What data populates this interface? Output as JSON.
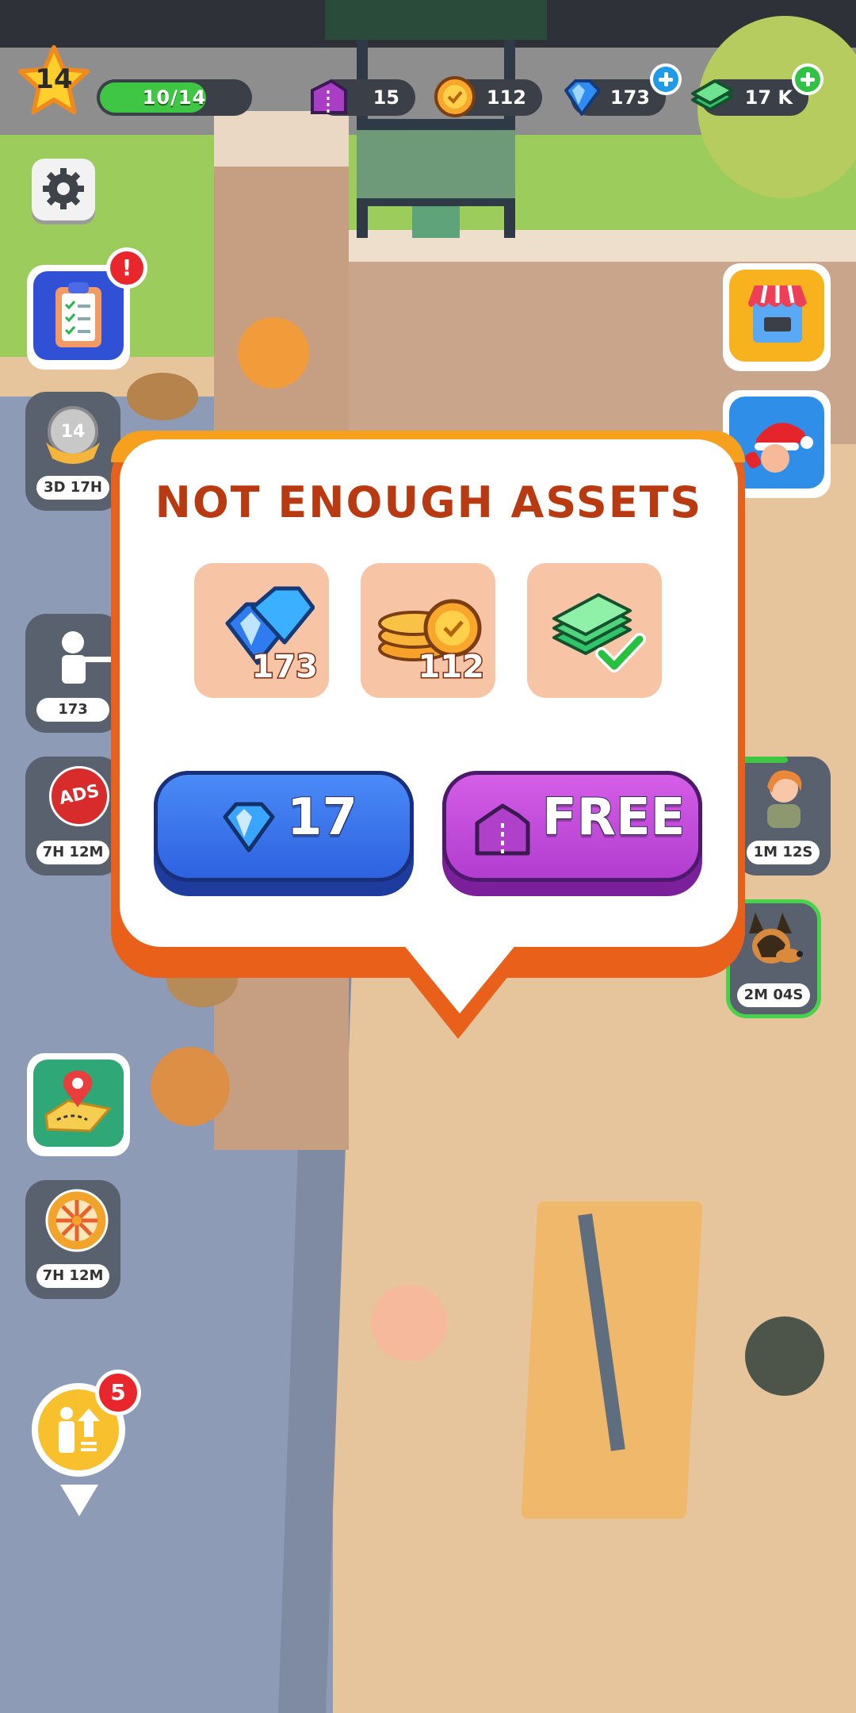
{
  "hud": {
    "level": "14",
    "xp_text": "10/14",
    "xp_progress": 0.714,
    "tickets": "15",
    "coins": "112",
    "gems": "173",
    "cash": "17 K"
  },
  "side_left": {
    "badge_level": "14",
    "badge_timer": "3D 17H",
    "soldier_count": "173",
    "ads_label": "ADS",
    "ads_timer": "7H 12M",
    "wheel_timer": "7H 12M",
    "upgrade_badge": "5",
    "tasks_alert": "!"
  },
  "side_right": {
    "recruit_timer": "1M 12S",
    "dog_timer": "2M 04S"
  },
  "popup": {
    "title": "NOT ENOUGH ASSETS",
    "assets": [
      {
        "name": "gems",
        "qty": "173"
      },
      {
        "name": "coins",
        "qty": "112"
      },
      {
        "name": "cash",
        "qty": ""
      }
    ],
    "gem_button_label": "17",
    "free_button_label": "FREE"
  },
  "colors": {
    "accent_orange": "#e9601a",
    "title_red": "#b93a10",
    "gem_blue": "#2f6fe6",
    "free_purple": "#b23ccf",
    "xp_green": "#3fc644"
  }
}
